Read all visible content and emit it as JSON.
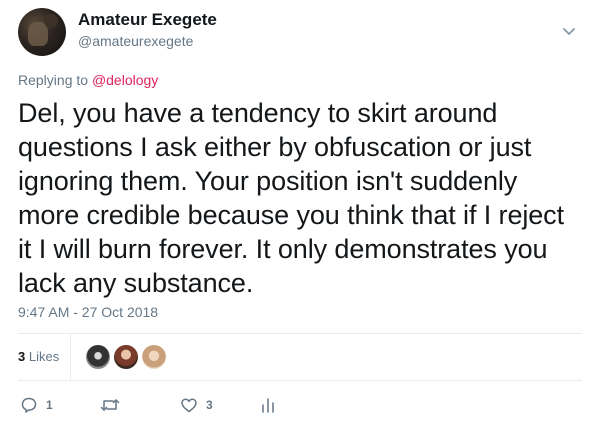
{
  "author": {
    "display_name": "Amateur Exegete",
    "handle": "@amateurexegete"
  },
  "reply": {
    "prefix": "Replying to",
    "mention": "@delology"
  },
  "tweet_text": "Del, you have a tendency to skirt around questions I ask either by obfuscation or just ignoring them. Your position isn't suddenly more credible because you think that if I reject it I will burn forever. It only demonstrates you lack any substance.",
  "timestamp": "9:47 AM - 27 Oct 2018",
  "likes": {
    "count": "3",
    "label": "Likes",
    "avatars": [
      "liker-avatar-1",
      "liker-avatar-2",
      "liker-avatar-3"
    ]
  },
  "actions": {
    "reply_count": "1",
    "retweet_count": "",
    "like_count": "3"
  },
  "icons": {
    "menu": "chevron-down-icon",
    "reply": "reply-icon",
    "retweet": "retweet-icon",
    "like": "heart-icon",
    "analytics": "analytics-icon"
  },
  "colors": {
    "mention": "#e0245e",
    "secondary_text": "#657786",
    "divider": "#e6ecf0"
  }
}
